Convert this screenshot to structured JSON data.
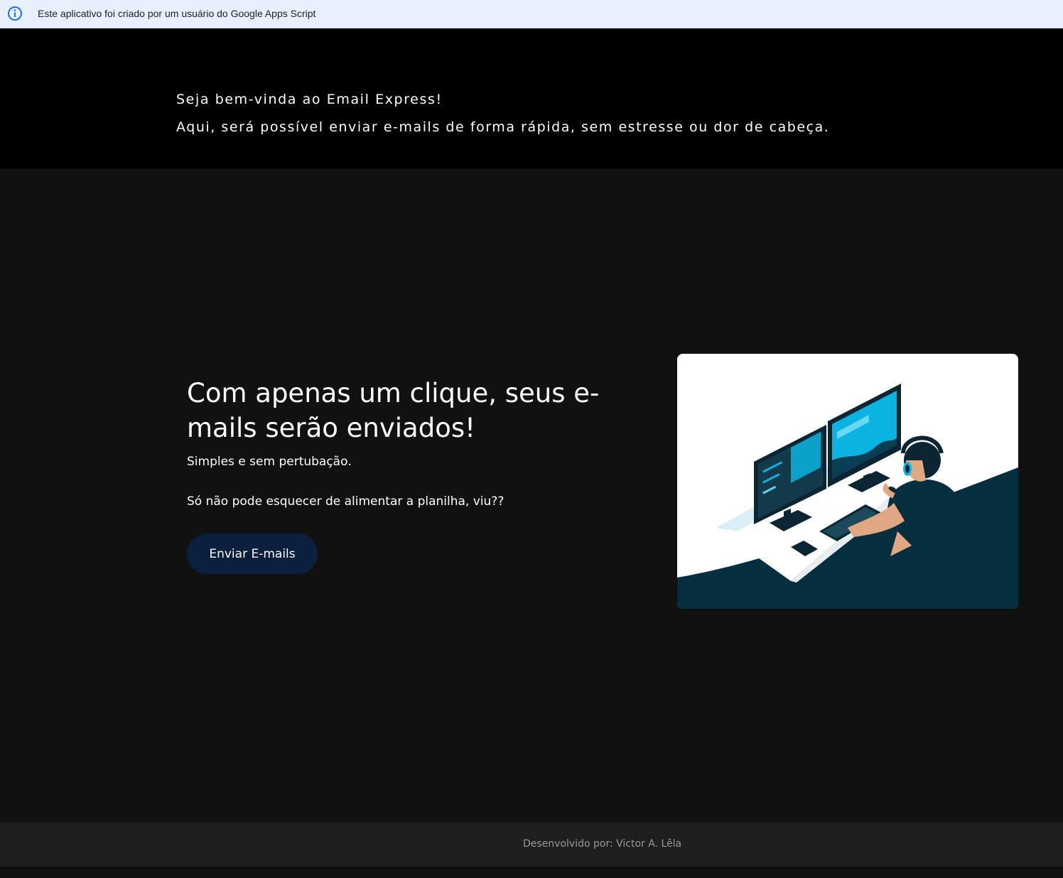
{
  "gas_banner": {
    "text": "Este aplicativo foi criado por um usuário do Google Apps Script",
    "icon": "info-icon"
  },
  "header": {
    "welcome": "Seja bem-vinda ao Email Express!",
    "subtitle": "Aqui, será possível enviar e-mails de forma rápida, sem estresse ou dor de cabeça."
  },
  "hero": {
    "headline": "Com apenas um clique, seus e-mails serão enviados!",
    "tagline": "Simples e sem pertubação.",
    "reminder": "Só não pode esquecer de alimentar a planilha, viu??",
    "button_label": "Enviar E-mails",
    "illustration": "person-at-computer-illustration"
  },
  "footer": {
    "credit": "Desenvolvido por: Victor A. Lêla"
  },
  "colors": {
    "banner_bg": "#e8f0fe",
    "header_bg": "#000000",
    "main_bg": "#111111",
    "button_bg": "#0b1f3f",
    "footer_bg": "#1e1e1e",
    "illustration_dark": "#052e3f",
    "illustration_accent": "#0bb4e0"
  }
}
